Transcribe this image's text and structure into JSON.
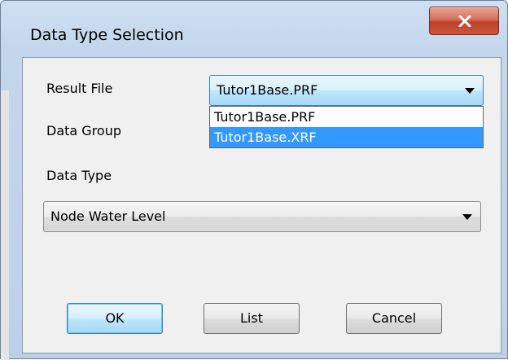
{
  "window": {
    "title": "Data Type Selection"
  },
  "form": {
    "result_file_label": "Result File",
    "result_file_value": "Tutor1Base.PRF",
    "result_file_options": [
      "Tutor1Base.PRF",
      "Tutor1Base.XRF"
    ],
    "result_file_highlighted": "Tutor1Base.XRF",
    "data_group_label": "Data Group",
    "data_type_label": "Data Type",
    "data_type_value": "Node Water Level"
  },
  "buttons": {
    "ok": "OK",
    "list": "List",
    "cancel": "Cancel"
  },
  "icons": {
    "close": "close-icon",
    "dropdown": "chevron-down-icon"
  },
  "colors": {
    "close_button": "#c9563c",
    "selection": "#3399ff",
    "dialog_face": "#f0f0f0"
  }
}
